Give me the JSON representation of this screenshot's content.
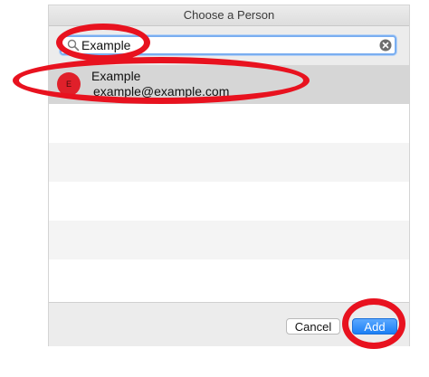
{
  "dialog": {
    "title": "Choose a Person"
  },
  "search": {
    "value": "Example",
    "icons": {
      "search": "magnifying-glass-icon",
      "clear": "clear-x-circle-icon"
    }
  },
  "results": [
    {
      "avatar_initial": "E",
      "name": "Example",
      "email": "example@example.com",
      "selected": true
    }
  ],
  "buttons": {
    "cancel_label": "Cancel",
    "add_label": "Add"
  },
  "colors": {
    "accent": "#1b7ff5",
    "annotation": "#e8121f",
    "avatar": "#e0202a",
    "selection": "#d6d6d6"
  }
}
